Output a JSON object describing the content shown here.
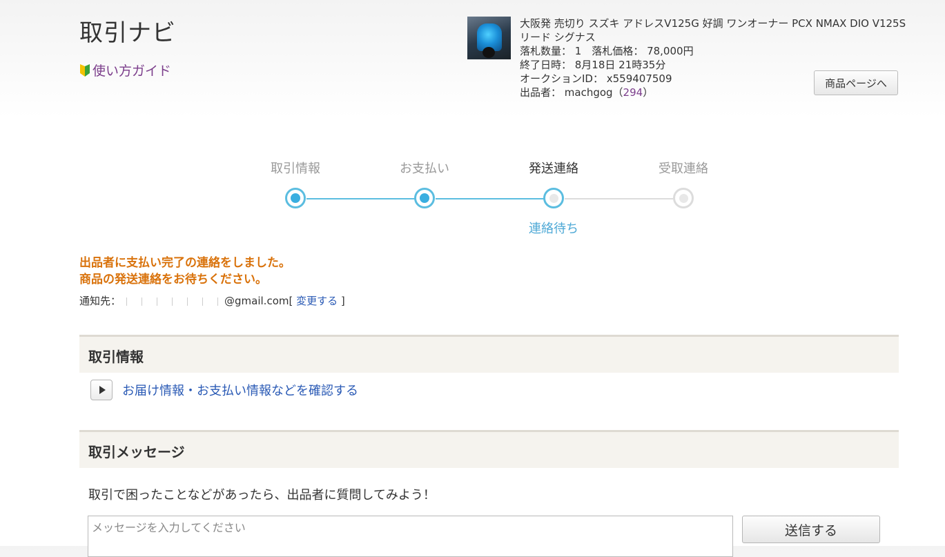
{
  "header": {
    "title": "取引ナビ",
    "guide_label": "使い方ガイド"
  },
  "product": {
    "title": "大阪発 売切り スズキ アドレスV125G 好調 ワンオーナー PCX NMAX DIO V125S リード シグナス",
    "quantity_line": "落札数量： 1　落札価格： 78,000円",
    "end_time_line": "終了日時： 8月18日 21時35分",
    "auction_id_line": "オークションID： x559407509",
    "seller_prefix": "出品者： machgog（",
    "seller_rating": "294",
    "seller_suffix": "）",
    "product_page_button": "商品ページへ"
  },
  "progress": {
    "steps": [
      {
        "label": "取引情報",
        "state": "done"
      },
      {
        "label": "お支払い",
        "state": "done"
      },
      {
        "label": "発送連絡",
        "state": "current"
      },
      {
        "label": "受取連絡",
        "state": "todo"
      }
    ],
    "current_status": "連絡待ち",
    "colors": {
      "active": "#5bbde0",
      "inactive": "#dcdcdc",
      "status": "#4ea9d6"
    }
  },
  "notice": {
    "line1": "出品者に支払い完了の連絡をしました。",
    "line2": "商品の発送連絡をお待ちください。",
    "color": "#d9720b"
  },
  "notification": {
    "prefix": "通知先：",
    "email_suffix": "@gmail.com[",
    "change_link": " 変更する ",
    "close": "]"
  },
  "transaction_info": {
    "heading": "取引情報",
    "expand_link": "お届け情報・お支払い情報などを確認する"
  },
  "messages": {
    "heading": "取引メッセージ",
    "prompt": "取引で困ったことなどがあったら、出品者に質問してみよう！",
    "input_placeholder": "メッセージを入力してください",
    "send_button": "送信する"
  }
}
